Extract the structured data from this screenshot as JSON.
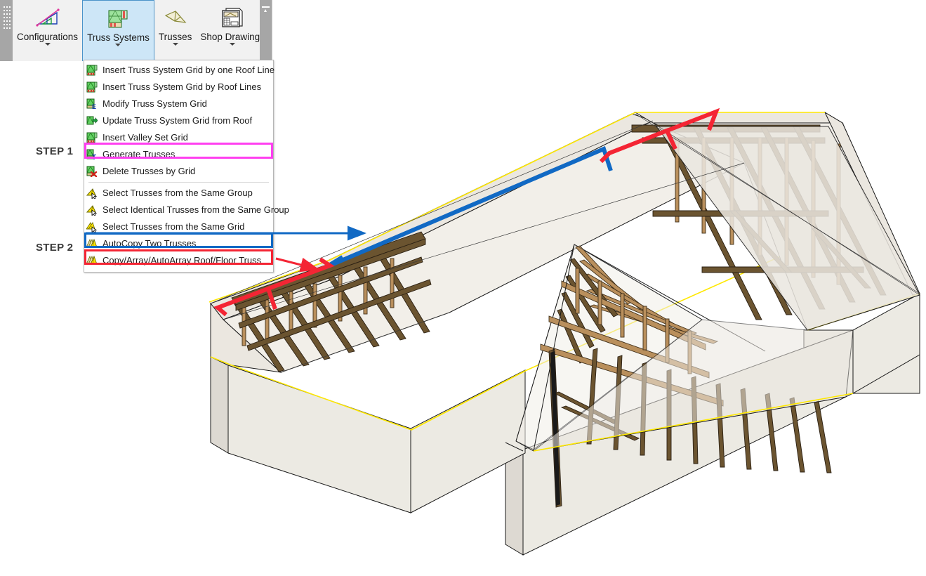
{
  "app": {
    "ribbon": {
      "grip_icon": "ribbon-grip-dots",
      "collapse_icon": "collapse-ribbon-pin-icon",
      "buttons": [
        {
          "id": "configurations",
          "label": "Configurations",
          "icon": "roof-pitch-triangle-icon",
          "has_caret": true,
          "active": false
        },
        {
          "id": "truss-systems",
          "label": "Truss Systems",
          "icon": "truss-system-grid-icon",
          "has_caret": true,
          "active": true
        },
        {
          "id": "trusses",
          "label": "Trusses",
          "icon": "truss-shape-icon",
          "has_caret": true,
          "active": false
        },
        {
          "id": "shop-drawings",
          "label": "Shop Drawings",
          "icon": "shop-drawing-sheet-icon",
          "has_caret": true,
          "active": false
        }
      ]
    },
    "menu": {
      "owner": "Truss Systems",
      "items": [
        {
          "label": "Insert Truss System Grid by one Roof Line",
          "icon": "truss-grid-green-icon",
          "type": "item",
          "highlight": "none"
        },
        {
          "label": "Insert Truss System Grid by Roof Lines",
          "icon": "truss-grid-green-icon",
          "type": "item",
          "highlight": "none"
        },
        {
          "label": "Modify Truss System Grid",
          "icon": "truss-grid-edit-icon",
          "type": "item",
          "highlight": "none"
        },
        {
          "label": "Update Truss System Grid from Roof",
          "icon": "truss-grid-update-icon",
          "type": "item",
          "highlight": "none"
        },
        {
          "label": "Insert Valley Set Grid",
          "icon": "truss-grid-green-icon",
          "type": "item",
          "highlight": "none"
        },
        {
          "label": "Generate Trusses",
          "icon": "truss-grid-generate-icon",
          "type": "item",
          "highlight": "magenta"
        },
        {
          "label": "Delete Trusses by Grid",
          "icon": "truss-grid-delete-icon",
          "type": "item",
          "highlight": "none"
        },
        {
          "label": "",
          "icon": "",
          "type": "separator",
          "highlight": "none"
        },
        {
          "label": "Select Trusses from the Same Group",
          "icon": "select-truss-group-icon",
          "type": "item",
          "highlight": "none"
        },
        {
          "label": "Select Identical Trusses from the Same Group",
          "icon": "select-identical-truss-icon",
          "type": "item",
          "highlight": "none"
        },
        {
          "label": "Select Trusses from the Same Grid",
          "icon": "select-truss-grid-icon",
          "type": "item",
          "highlight": "none"
        },
        {
          "label": "AutoCopy Two Trusses",
          "icon": "autocopy-trusses-icon",
          "type": "item",
          "highlight": "blue"
        },
        {
          "label": "Copy/Array/AutoArray Roof/Floor Truss",
          "icon": "copy-array-truss-icon",
          "type": "item",
          "highlight": "red"
        }
      ]
    },
    "annotations": {
      "step1_label": "STEP 1",
      "step2_label": "STEP 2",
      "colors": {
        "magenta_highlight": "#ff3ff0",
        "blue_callout": "#1169c4",
        "red_callout": "#f42534",
        "ribbon_active": "#cde6f7",
        "ribbon_active_border": "#4b93c9",
        "ribbon_bg": "#f1f1f1",
        "grip_bg": "#a6a6a6"
      },
      "callouts": [
        {
          "name": "blue-bracket-on-ridge",
          "color": "#1169c4",
          "target": "upper ridge truss line",
          "source_item": "AutoCopy Two Trusses"
        },
        {
          "name": "red-bracket-on-ridge",
          "color": "#f42534",
          "target": "gable end truss pair",
          "source_item": "Copy/Array/AutoArray Roof/Floor Truss"
        }
      ]
    },
    "model": {
      "name": "hip-and-gable-roof-truss-assembly",
      "description": "3D wireframe/shaded CAD view of a residential roof truss system with two wings meeting at a valley",
      "colors": {
        "timber": "#b08a5a",
        "timber_dark": "#5a4426",
        "roof_plane": "#ebe7e0",
        "wall": "#e9e5de",
        "wall_shadow": "#d9d5ce",
        "outline": "#1a1a1a",
        "edge_highlight": "#ffff33"
      }
    }
  }
}
